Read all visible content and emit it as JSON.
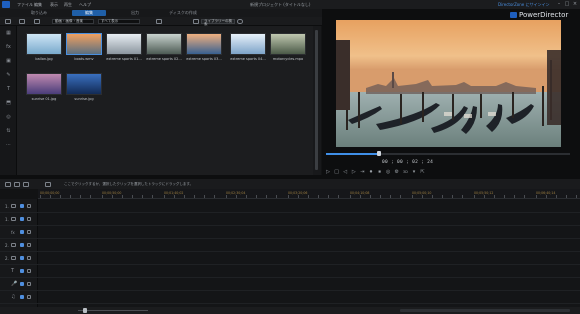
{
  "titlebar": {
    "menu": [
      "ファイル",
      "編集",
      "表示",
      "再生",
      "ヘルプ"
    ],
    "project_title": "新規プロジェクト (タイトルなし)",
    "signin": "DirectorZone にサインイン",
    "min": "–",
    "max": "□",
    "close": "×"
  },
  "modes": {
    "capture": "取り込み",
    "edit": "編集",
    "produce": "出力",
    "disc": "ディスクの作成"
  },
  "library": {
    "filter": "動画・画像・音楽",
    "sort": "すべて表示",
    "library_menu": "ライブラリーの検索",
    "items": [
      {
        "name": "ballon.jpg",
        "colors": [
          "#cfe6f5",
          "#79a9cc"
        ]
      },
      {
        "name": "boats.wmv",
        "colors": [
          "#f0a060",
          "#5a6f80"
        ]
      },
      {
        "name": "extreme sports 01...",
        "colors": [
          "#e8eef3",
          "#8c969f"
        ]
      },
      {
        "name": "extreme sports 02...",
        "colors": [
          "#c9d3cf",
          "#4d5b54"
        ]
      },
      {
        "name": "extreme sports 03...",
        "colors": [
          "#f0b080",
          "#386090"
        ]
      },
      {
        "name": "extreme sports 04...",
        "colors": [
          "#e8f2fa",
          "#7da3c8"
        ]
      },
      {
        "name": "motorcycles.mpo",
        "colors": [
          "#c0c8b0",
          "#4b5a48"
        ]
      },
      {
        "name": "sunrise 01.jpg",
        "colors": [
          "#c08ab0",
          "#4a3d7a"
        ]
      },
      {
        "name": "sunrise.jpg",
        "colors": [
          "#3a70c0",
          "#122a55"
        ]
      }
    ]
  },
  "leftrail": {
    "icons": [
      "▦",
      "fx",
      "▣",
      "✎",
      "T",
      "⬒",
      "◎",
      "⇅",
      "⋯"
    ]
  },
  "brand": "PowerDirector",
  "preview": {
    "timecode": "00 ; 00 ; 02 ; 24",
    "progress_fraction": 0.22,
    "controls": [
      "▷",
      "□",
      "◁",
      "▷",
      "⇥",
      "⏺",
      "⏹",
      "◎",
      "⚙",
      "3D",
      "▾",
      "⇱"
    ]
  },
  "timeline": {
    "hint": "ここでクリックするか、選択したクリップを選択したトラックにドラッグします。",
    "ruler_labels": [
      "00;00;00;00",
      "00;00;50;00",
      "00;01;40;02",
      "00;02;30;04",
      "00;03;20;06",
      "00;04;10;08",
      "00;05;00;10",
      "00;05;50;12",
      "00;06;40;14"
    ],
    "tracks": [
      {
        "num": "1.",
        "kind": "video"
      },
      {
        "num": "1.",
        "kind": "audio"
      },
      {
        "num": "",
        "kind": "fx"
      },
      {
        "num": "2.",
        "kind": "video"
      },
      {
        "num": "2.",
        "kind": "audio"
      },
      {
        "num": "",
        "kind": "title"
      },
      {
        "num": "",
        "kind": "voice"
      },
      {
        "num": "",
        "kind": "music"
      }
    ]
  }
}
